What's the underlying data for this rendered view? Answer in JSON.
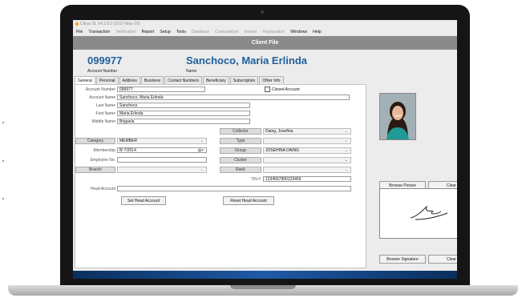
{
  "window": {
    "title": "Citrus SL V4.3.9.0 (2017-May-20)"
  },
  "menu": [
    {
      "label": "File",
      "enabled": true
    },
    {
      "label": "Transaction",
      "enabled": true
    },
    {
      "label": "Verification",
      "enabled": false
    },
    {
      "label": "Report",
      "enabled": true
    },
    {
      "label": "Setup",
      "enabled": true
    },
    {
      "label": "Tools",
      "enabled": true
    },
    {
      "label": "Database",
      "enabled": false
    },
    {
      "label": "Computation",
      "enabled": false
    },
    {
      "label": "Events",
      "enabled": false
    },
    {
      "label": "Registration",
      "enabled": false
    },
    {
      "label": "Windows",
      "enabled": true
    },
    {
      "label": "Help",
      "enabled": true
    }
  ],
  "header": {
    "title": "Client File"
  },
  "client": {
    "account_number": "099977",
    "account_number_label": "Account Number",
    "name": "Sanchoco, Maria Erlinda",
    "name_label": "Name"
  },
  "tabs": [
    "General",
    "Personal",
    "Address",
    "Business",
    "Contact Numbers",
    "Beneficiary",
    "Subscription",
    "Other Info"
  ],
  "form": {
    "account_number": {
      "label": "Account Number",
      "value": "099977"
    },
    "closed_account": {
      "label": "Closed Account",
      "checked": false
    },
    "account_name": {
      "label": "Account Name",
      "value": "Sanchoco, Maria Erlinda"
    },
    "last_name": {
      "label": "Last Name",
      "value": "Sanchoco"
    },
    "first_name": {
      "label": "First Name",
      "value": "Maria Erlinda"
    },
    "middle_name": {
      "label": "Middle Name",
      "value": "Briguela"
    },
    "collector": {
      "label": "Collector",
      "value": "Daing, Josefina"
    },
    "category": {
      "label": "Category",
      "value": "MEMBER"
    },
    "type": {
      "label": "Type",
      "value": ""
    },
    "membership": {
      "label": "Membership",
      "value": "8/ 7/2014"
    },
    "group": {
      "label": "Group",
      "value": "JOSEHINA DAING"
    },
    "employee_no": {
      "label": "Employee No.",
      "value": ""
    },
    "cluster": {
      "label": "Cluster",
      "value": ""
    },
    "branch": {
      "label": "Branch",
      "value": ""
    },
    "rank": {
      "label": "Rank",
      "value": ""
    },
    "tin": {
      "label": "TIN #",
      "value": "1234567890123456"
    },
    "head_account": {
      "label": "Head Account",
      "value": ""
    },
    "set_head_button": "Set Head Account",
    "reset_head_button": "Reset Head Account"
  },
  "photo_buttons": {
    "browse": "Browse Picture",
    "clear": "Clear"
  },
  "signature_buttons": {
    "browse": "Browse Signature",
    "clear": "Clear"
  },
  "colors": {
    "accent": "#1f5f9e",
    "header_bg": "#8a8a8a",
    "taskbar": "#1e5aa6"
  }
}
